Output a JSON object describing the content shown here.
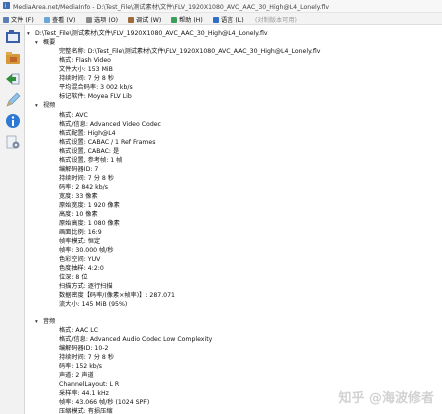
{
  "window": {
    "title": "MediaArea.net/MediaInfo - D:\\Test_File\\测试素材\\文件\\FLV_1920X1080_AVC_AAC_30_High@L4_Lonely.flv"
  },
  "menu": [
    {
      "label": "文件 (F)",
      "color": "#5a7fb5"
    },
    {
      "label": "查看 (V)",
      "color": "#6aa6d6"
    },
    {
      "label": "选项 (O)",
      "color": "#8a8a8a"
    },
    {
      "label": "调试 (W)",
      "color": "#9d6c3c"
    },
    {
      "label": "帮助 (H)",
      "color": "#3aa05a"
    },
    {
      "label": "语言 (L)",
      "color": "#2f6fc6"
    },
    {
      "label": "(对制版本可用)",
      "color": "#bbbbbb"
    }
  ],
  "tree": {
    "root": "D:\\Test_File\\测试素材\\文件\\FLV_1920X1080_AVC_AAC_30_High@L4_Lonely.flv",
    "general_header": "概要",
    "general": [
      "完整名称: D:\\Test_File\\测试素材\\文件\\FLV_1920X1080_AVC_AAC_30_High@L4_Lonely.flv",
      "格式: Flash Video",
      "文件大小: 153 MiB",
      "持续时间: 7 分 8 秒",
      "平均混合码率: 3 002 kb/s",
      "标记软件: Moyea FLV Lib"
    ],
    "video_header": "视频",
    "video": [
      "格式: AVC",
      "格式/信息: Advanced Video Codec",
      "格式配置: High@L4",
      "格式设置: CABAC / 1 Ref Frames",
      "格式设置, CABAC: 是",
      "格式设置, 参考帧: 1 帧",
      "编解码器ID: 7",
      "持续时间: 7 分 8 秒",
      "码率: 2 842 kb/s",
      "宽度: 33 像素",
      "原始宽度: 1 920 像素",
      "高度: 10 像素",
      "原始高度: 1 080 像素",
      "画面比例: 16:9",
      "帧率模式: 恒定",
      "帧率: 30.000 帧/秒",
      "色彩空间: YUV",
      "色度抽样: 4:2:0",
      "位深: 8 位",
      "扫描方式: 逐行扫描",
      "数据密度【码率/(像素×帧率)】: 287.071",
      "流大小: 145 MiB (95%)"
    ],
    "audio_header": "音频",
    "audio": [
      "格式: AAC LC",
      "格式/信息: Advanced Audio Codec Low Complexity",
      "编解码器ID: 10-2",
      "持续时间: 7 分 8 秒",
      "码率: 152 kb/s",
      "声道: 2 声道",
      "ChannelLayout: L R",
      "采样率: 44.1 kHz",
      "帧率: 43.066 帧/秒 (1024 SPF)",
      "压缩模式: 有损压缩"
    ]
  },
  "watermark": "知乎 @海波修者"
}
